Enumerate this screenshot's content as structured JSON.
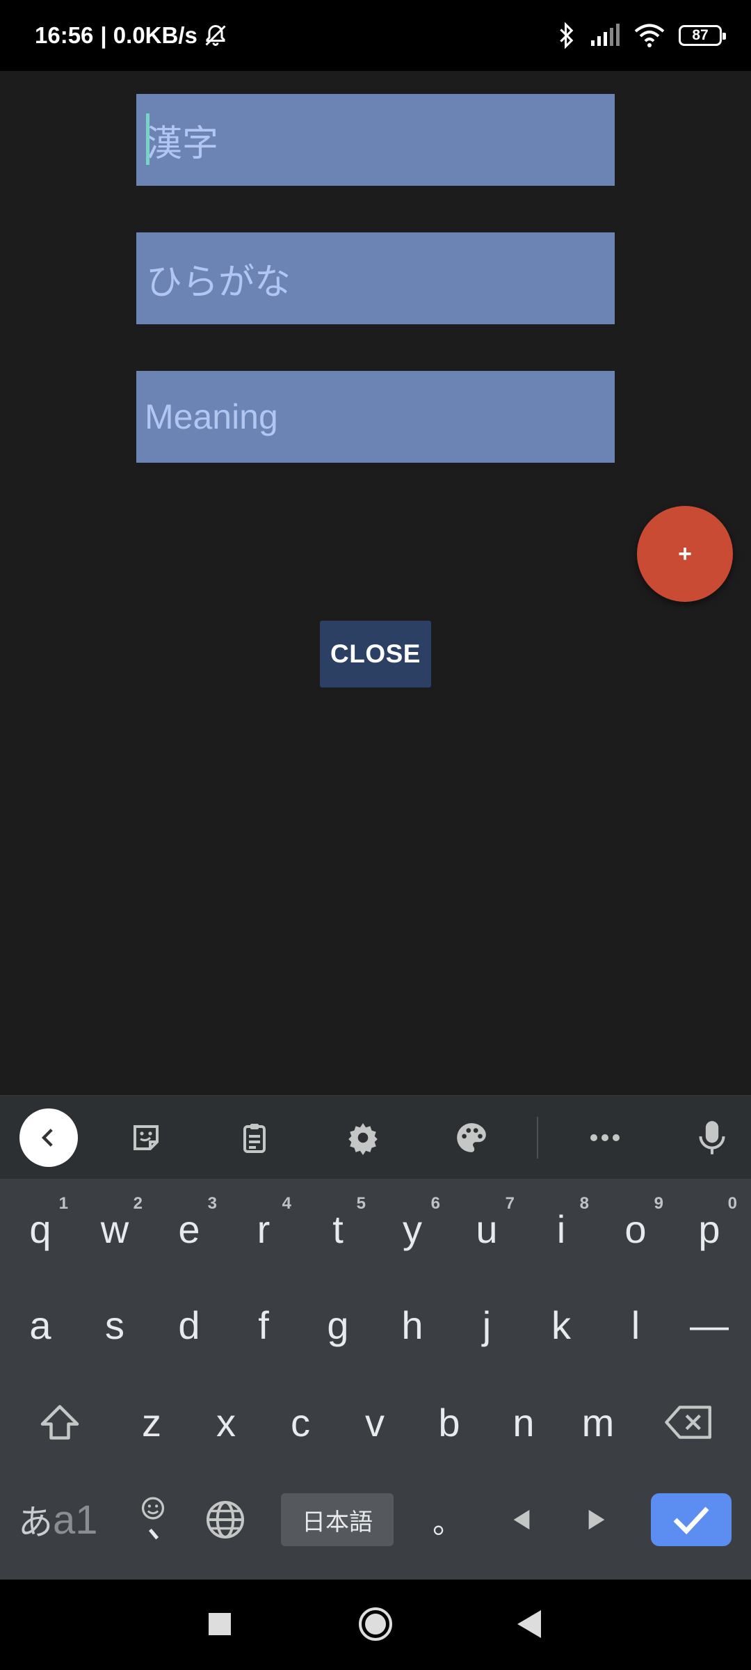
{
  "status_bar": {
    "time": "16:56",
    "speed": "| 0.0KB/s",
    "battery": "87"
  },
  "form": {
    "kanji_placeholder": "漢字",
    "hiragana_placeholder": "ひらがな",
    "meaning_placeholder": "Meaning",
    "fab_label": "+",
    "close_label": "CLOSE"
  },
  "keyboard": {
    "row1": [
      {
        "key": "q",
        "hint": "1"
      },
      {
        "key": "w",
        "hint": "2"
      },
      {
        "key": "e",
        "hint": "3"
      },
      {
        "key": "r",
        "hint": "4"
      },
      {
        "key": "t",
        "hint": "5"
      },
      {
        "key": "y",
        "hint": "6"
      },
      {
        "key": "u",
        "hint": "7"
      },
      {
        "key": "i",
        "hint": "8"
      },
      {
        "key": "o",
        "hint": "9"
      },
      {
        "key": "p",
        "hint": "0"
      }
    ],
    "row2": [
      "a",
      "s",
      "d",
      "f",
      "g",
      "h",
      "j",
      "k",
      "l",
      "—"
    ],
    "row3": [
      "z",
      "x",
      "c",
      "v",
      "b",
      "n",
      "m"
    ],
    "mode_kana": "あ",
    "mode_alpha": "a1",
    "language_key": "日本語",
    "period_key": "。"
  },
  "colors": {
    "background": "#1c1c1c",
    "field": "#6b84b3",
    "placeholder": "#b1c6f2",
    "fab": "#c94b34",
    "close_button": "#2b4062",
    "enter_key": "#5b8ef0"
  }
}
